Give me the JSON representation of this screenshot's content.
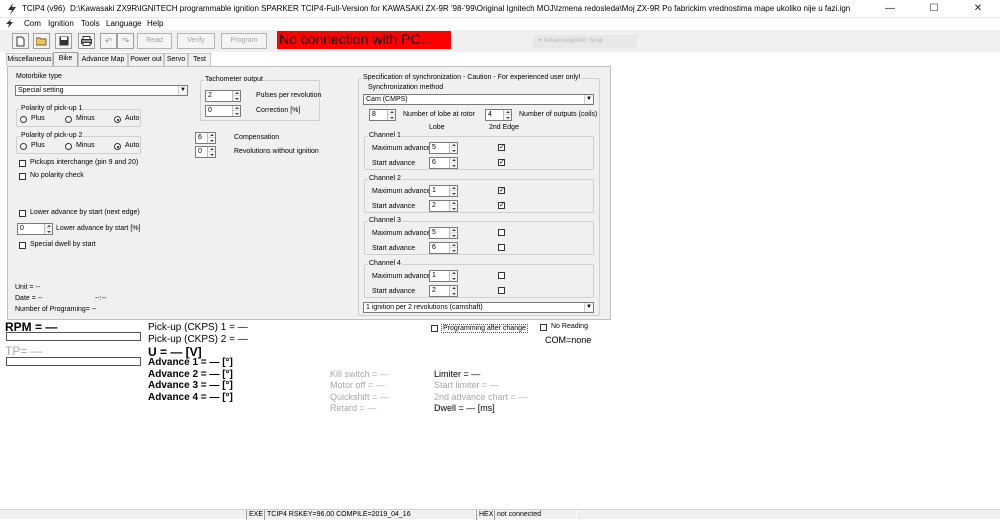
{
  "window": {
    "app_name": "TCIP4 (v96)",
    "file_path": "D:\\Kawasaki ZX9R\\IGNITECH programmable ignition SPARKER TCIP4-Full-Version for KAWASAKI ZX-9R '98-'99\\Original Ignitech MOJ\\Izmena redosleda\\Moj ZX-9R Po fabrickim vrednostima mape ukoliko nije u fazi.ign",
    "minimize": "—",
    "maximize": "☐",
    "close": "✕"
  },
  "menu": [
    "Com",
    "Ignition",
    "Tools",
    "Language",
    "Help"
  ],
  "toolbar": {
    "read": "Read",
    "verify": "Verify",
    "program": "Program",
    "no_connection": "No connection with PC...",
    "advance_snap": "Advance/ignition Snap"
  },
  "tabs": [
    "Miscellaneous",
    "Bike",
    "Advance Map",
    "Power out",
    "Servo",
    "Test"
  ],
  "bike": {
    "motorbike_type_label": "Motorbike type",
    "motorbike_type_value": "Special setting",
    "polarity1_label": "Polarity of pick-up 1",
    "polarity2_label": "Polarity of pick-up 2",
    "plus": "Plus",
    "minus": "Minus",
    "auto": "Auto",
    "pickups_interchange": "Pickups interchange (pin 9 and 20)",
    "no_polarity_check": "No polarity check",
    "lower_advance_edge": "Lower advance by start (next edge)",
    "lower_advance_value": "0",
    "lower_advance_label": "Lower advance by start [%]",
    "special_dwell": "Special dwell by start",
    "unit_label": "Unit = --",
    "date_label": "Date = --",
    "date_time": "--:--",
    "num_programing": "Number of Programing= --"
  },
  "tacho": {
    "title": "Tachometer output",
    "pulses_value": "2",
    "pulses_label": "Pulses per revolution",
    "correction_value": "0",
    "correction_label": "Correction [%]",
    "compensation_value": "6",
    "compensation_label": "Compensation",
    "rev_value": "0",
    "rev_label": "Revolutions without ignition"
  },
  "sync": {
    "title": "Specification of synchronization - Caution - For experienced user only!",
    "method_label": "Synchronization method",
    "method_value": "Cam (CMPS)",
    "lobe_value": "8",
    "lobe_label": "Number of lobe at rotor",
    "outputs_value": "4",
    "outputs_label": "Number of outputs (coils)",
    "col_lobe": "Lobe",
    "col_2nd": "2nd Edge",
    "max_adv_label": "Maximum advance",
    "start_adv_label": "Start advance",
    "channels": [
      {
        "title": "Channel 1",
        "max": "5",
        "start": "6",
        "max_chk": "✓",
        "start_chk": "✓"
      },
      {
        "title": "Channel 2",
        "max": "1",
        "start": "2",
        "max_chk": "✓",
        "start_chk": "✓"
      },
      {
        "title": "Channel 3",
        "max": "5",
        "start": "6",
        "max_chk": "",
        "start_chk": ""
      },
      {
        "title": "Channel 4",
        "max": "1",
        "start": "2",
        "max_chk": "",
        "start_chk": ""
      }
    ],
    "ignition_mode": "1 ignition per 2 revolutions (camshaft)"
  },
  "readout": {
    "rpm": "RPM = —",
    "tp": "TP= —",
    "ckps1": "Pick-up (CKPS) 1 = —",
    "ckps2": "Pick-up (CKPS) 2 = —",
    "voltage": "U = — [V]",
    "adv1": "Advance 1 = — [°]",
    "adv2": "Advance 2 = — [°]",
    "adv3": "Advance 3 = — [°]",
    "adv4": "Advance 4 = — [°]",
    "kill": "Kill switch = —",
    "motor_off": "Motor off = —",
    "quickshift": "Quickshift = —",
    "retard": "Retard = —",
    "limiter": "Limiter = —",
    "start_limiter": "Start limiter = —",
    "second_chart": "2nd advance chart = —",
    "dwell": "Dwell = — [ms]",
    "programming_after_change": "Programming after change",
    "no_reading": "No Reading",
    "com": "COM=none"
  },
  "statusbar": {
    "exe": "EXE",
    "info": "TCIP4   RSKEY=96.00   COMPILE=2019_04_16",
    "hex": "HEX",
    "state": "not connected"
  }
}
